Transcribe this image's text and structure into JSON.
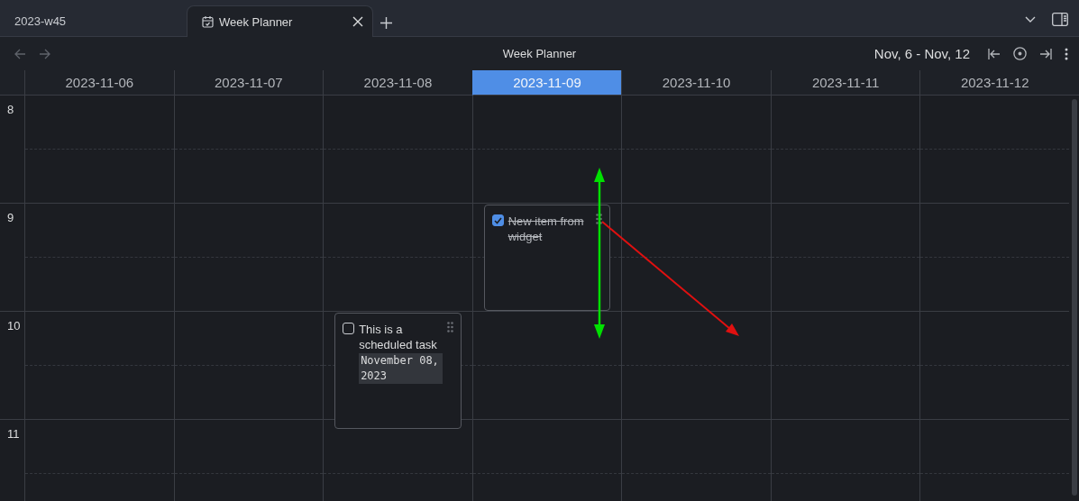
{
  "tabs": [
    {
      "label": "2023-w45",
      "selected": false
    },
    {
      "label": "Week Planner",
      "selected": true
    }
  ],
  "toolbar": {
    "title": "Week Planner",
    "range": "Nov, 6 - Nov, 12"
  },
  "hours": [
    "8",
    "9",
    "10",
    "11"
  ],
  "days": [
    {
      "label": "2023-11-06",
      "selected": false
    },
    {
      "label": "2023-11-07",
      "selected": false
    },
    {
      "label": "2023-11-08",
      "selected": false,
      "tasks": [
        {
          "text": "This is a scheduled task",
          "date": "November 08, 2023",
          "checked": false
        }
      ]
    },
    {
      "label": "2023-11-09",
      "selected": true,
      "tasks": [
        {
          "text": "New item from widget",
          "checked": true
        }
      ]
    },
    {
      "label": "2023-11-10",
      "selected": false
    },
    {
      "label": "2023-11-11",
      "selected": false
    },
    {
      "label": "2023-11-12",
      "selected": false
    }
  ]
}
